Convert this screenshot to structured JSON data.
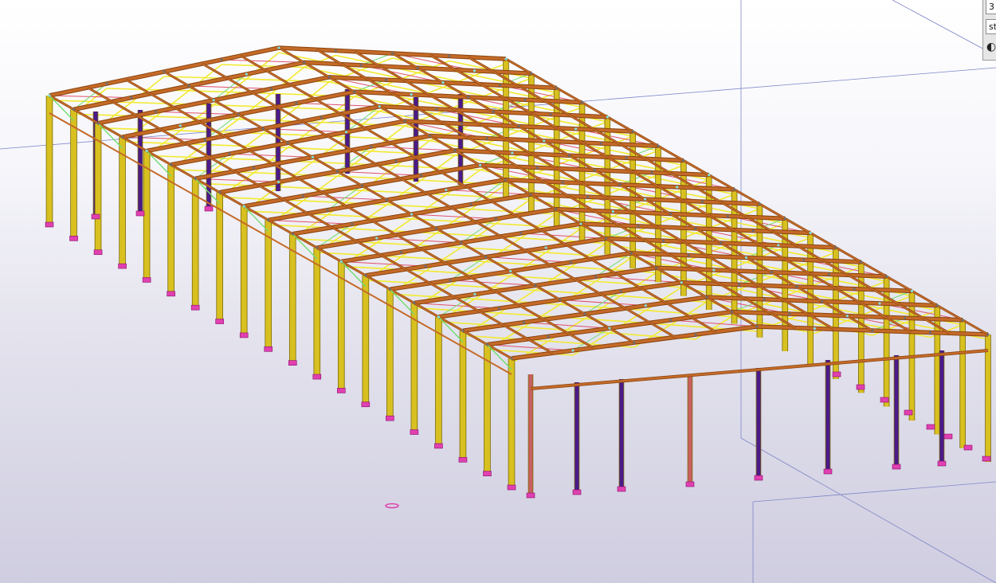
{
  "viewport": {
    "title": "",
    "colors": {
      "column": "#d8c020",
      "column_edge": "#7a6a06",
      "bracing_column": "#4a1a8a",
      "end_column": "#c86060",
      "rafter": "#c46a28",
      "rafter_edge": "#8a4410",
      "purlin": "#c46a28",
      "roof_bracing": "#f2ea30",
      "red_bracing": "#e0506a",
      "green_bracing": "#70dc70",
      "cyan_node": "#80e0e0",
      "base_plate": "#e040b0",
      "gridline": "#7f86c8"
    }
  },
  "panel": {
    "field1_value": "3",
    "field2_value": "st",
    "visibility_icon": "eye-icon",
    "visibility_glyph": "◐"
  }
}
